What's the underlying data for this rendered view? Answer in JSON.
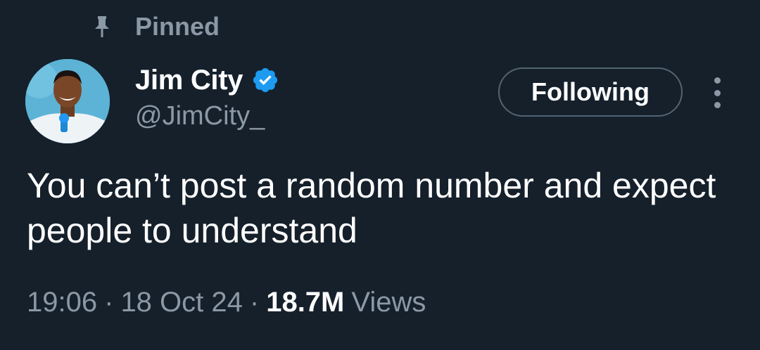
{
  "pinned": {
    "label": "Pinned",
    "icon": "pin-icon"
  },
  "author": {
    "name": "Jim City",
    "handle": "@JimCity_",
    "verified": true,
    "verified_icon": "verified-badge-icon",
    "verified_color": "#1d9bf0"
  },
  "actions": {
    "follow_label": "Following",
    "more_icon": "more-vertical-icon"
  },
  "tweet": {
    "text": "You can’t post a random number and expect people to understand"
  },
  "meta": {
    "time": "19:06",
    "date": "18 Oct 24",
    "separator": "·",
    "views_count": "18.7M",
    "views_label": "Views"
  },
  "colors": {
    "background": "#15202b",
    "secondary_text": "#8b98a5",
    "primary_text": "#ffffff",
    "accent": "#1d9bf0"
  }
}
